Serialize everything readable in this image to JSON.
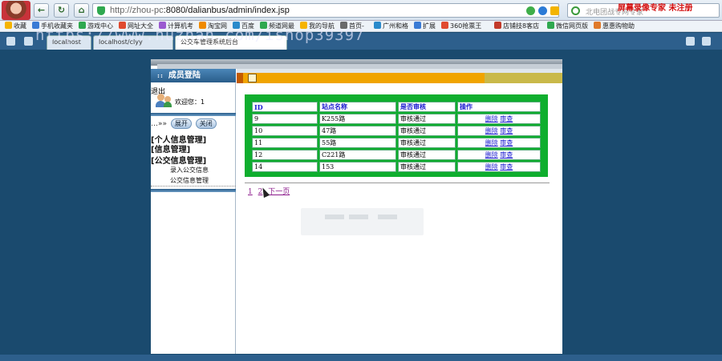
{
  "browser": {
    "url_host": "http://zhou-pc",
    "url_rest": ":8080/dalianbus/admin/index.jsp",
    "search_placeholder": "北电团战专网专家",
    "recorder_watermark": "屏幕录像专家 未注册",
    "overlay_watermark": "https://www.huzhan.com/ishop39397",
    "bookmarks": [
      "收藏",
      "手机收藏夹",
      "游戏中心",
      "网址大全",
      "计算机考",
      "淘宝网",
      "百度",
      "频道网最",
      "我的导航",
      "首页-",
      "广州和格",
      "扩展",
      "360抢票王",
      "店铺技8客店",
      "微信网页版",
      "惠惠购物助"
    ],
    "tabs": [
      "localhost",
      "localhost/clyy",
      "公交车管理系统后台"
    ]
  },
  "sidebar": {
    "title": "成员登陆",
    "logout": "退出",
    "welcome": "欢迎您：1",
    "expand_label": "展开",
    "collapse_label": "关闭",
    "groups": [
      {
        "label": "[个人信息管理]"
      },
      {
        "label": "[信息管理]"
      },
      {
        "label": "[公交信息管理]"
      }
    ],
    "items": [
      "录入公交信息",
      "公交信息管理"
    ]
  },
  "table": {
    "headers": [
      "ID",
      "站点名称",
      "是否审核",
      "操作"
    ],
    "rows": [
      {
        "id": "9",
        "name": "K255路",
        "status": "审核通过",
        "delete": "删除",
        "review": "审查"
      },
      {
        "id": "10",
        "name": "47路",
        "status": "审核通过",
        "delete": "删除",
        "review": "审查"
      },
      {
        "id": "11",
        "name": "55路",
        "status": "审核通过",
        "delete": "删除",
        "review": "审查"
      },
      {
        "id": "12",
        "name": "C221路",
        "status": "审核通过",
        "delete": "删除",
        "review": "审查"
      },
      {
        "id": "14",
        "name": "153",
        "status": "审核通过",
        "delete": "删除",
        "review": "审查"
      }
    ]
  },
  "pager": {
    "page1": "1",
    "page2": "2",
    "next": "下一页"
  },
  "colors": {
    "grid_frame": "#0fae2e",
    "orange_bar": "#f0a400",
    "desktop": "#1a4a6e",
    "link": "#1a1ad0"
  }
}
